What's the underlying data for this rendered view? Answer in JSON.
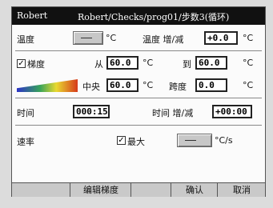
{
  "title": {
    "left": "Robert",
    "right": "Robert/Checks/prog01/步数3(循环)"
  },
  "temp": {
    "label": "温度",
    "unit": "°C",
    "incr_label": "温度 增/减",
    "incr_value": "+0.0",
    "incr_unit": "°C"
  },
  "gradient": {
    "checkbox_label": "梯度",
    "checkbox_mark": "✓",
    "from_label": "从",
    "from_value": "60.0",
    "from_unit": "°C",
    "to_label": "到",
    "to_value": "60.0",
    "to_unit": "°C",
    "center_label": "中央",
    "center_value": "60.0",
    "center_unit": "°C",
    "span_label": "跨度",
    "span_value": "0.0",
    "span_unit": "°C"
  },
  "time": {
    "label": "时间",
    "value": "000:15",
    "incr_label": "时间 增/减",
    "incr_value": "+00:00"
  },
  "rate": {
    "label": "速率",
    "max_label": "最大",
    "max_mark": "✓",
    "unit": "°C/s"
  },
  "buttons": {
    "edit_gradient": "编辑梯度",
    "confirm": "确认",
    "cancel": "取消"
  },
  "colors": {
    "titlebar": "#111111",
    "gradient": [
      "#2d33c8",
      "#37a35a",
      "#e9d930",
      "#d63a1b"
    ]
  }
}
